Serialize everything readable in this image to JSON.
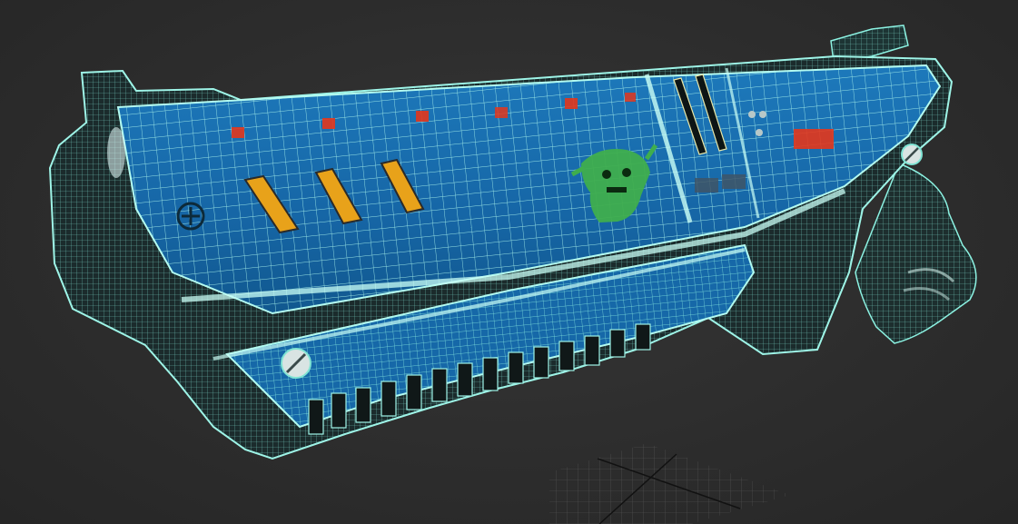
{
  "viewport": {
    "background_color": "#2b2b2b",
    "wireframe_color": "#7ff2e0",
    "texture_color": "#1a6fb0",
    "dark_shell_color": "#1b2a2a",
    "accent_red": "#e3361c",
    "accent_orange": "#e8a21a",
    "decal_green": "#3fae4d"
  },
  "scene": {
    "object": "sci-fi-gun-model",
    "grid_visible": true,
    "gizmo_visible": true
  }
}
